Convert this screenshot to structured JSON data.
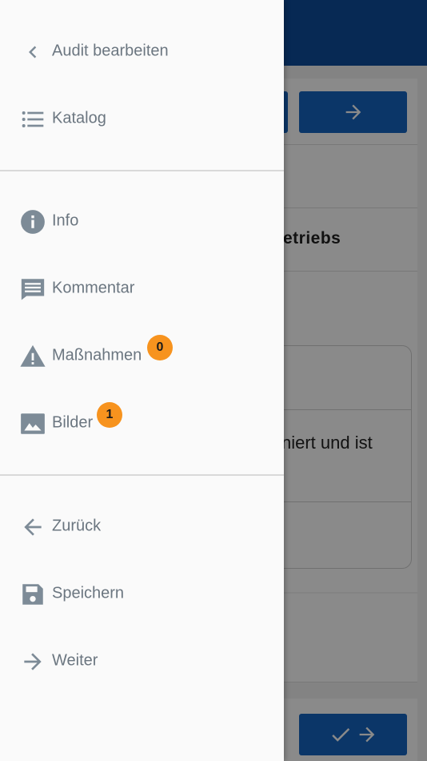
{
  "drawer": {
    "items": [
      {
        "label": "Audit bearbeiten",
        "icon": "chevron-left-icon"
      },
      {
        "label": "Katalog",
        "icon": "list-icon"
      },
      {
        "label": "Info",
        "icon": "info-icon"
      },
      {
        "label": "Kommentar",
        "icon": "comment-icon"
      },
      {
        "label": "Maßnahmen",
        "icon": "warning-icon",
        "badge": "0"
      },
      {
        "label": "Bilder",
        "icon": "image-icon",
        "badge": "1"
      },
      {
        "label": "Zurück",
        "icon": "arrow-left-icon"
      },
      {
        "label": "Speichern",
        "icon": "save-icon"
      },
      {
        "label": "Weiter",
        "icon": "arrow-right-icon"
      }
    ]
  },
  "background": {
    "section_title_fragment": "etriebs",
    "question_fragment": "niert und ist"
  },
  "colors": {
    "app_bar": "#0d4d9c",
    "button": "#1565c0",
    "badge": "#f7931e",
    "icon": "#7d8b97",
    "drawer_background": "#fafafa"
  }
}
